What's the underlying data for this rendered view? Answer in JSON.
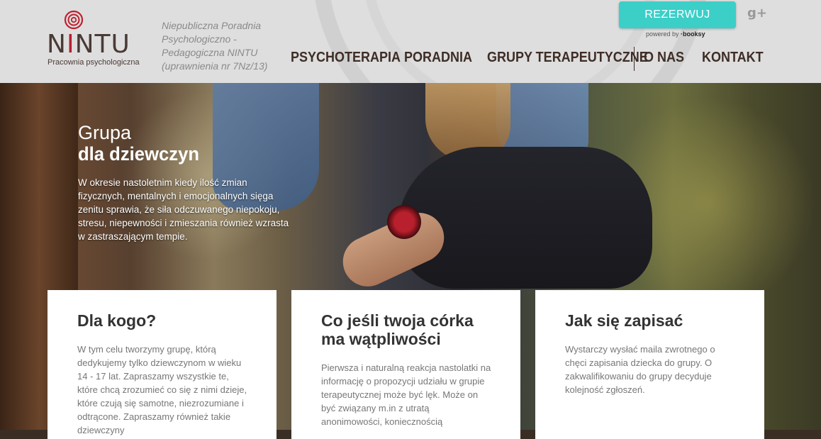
{
  "brand": {
    "name_before": "N",
    "name_i": "I",
    "name_after": "NTU",
    "subtitle": "Pracownia psychologiczna"
  },
  "tagline": [
    "Niepubliczna Poradnia",
    "Psychologiczno -",
    "Pedagogiczna NINTU",
    "(uprawnienia nr 7Nz/13)"
  ],
  "reserve": {
    "label": "REZERWUJ",
    "powered_prefix": "powered by",
    "powered_brand": "booksy",
    "color": "#3bcfc8"
  },
  "social": {
    "icon": "google-plus-icon",
    "glyph": "g+"
  },
  "nav": {
    "items": [
      {
        "label": "PSYCHOTERAPIA"
      },
      {
        "label": "PORADNIA"
      },
      {
        "label": "GRUPY TERAPEUTYCZNE"
      },
      {
        "label": "O NAS"
      },
      {
        "label": "KONTAKT"
      }
    ]
  },
  "hero": {
    "title_line1": "Grupa",
    "title_line2": "dla dziewczyn",
    "text": "W okresie nastoletnim kiedy ilość zmian fizycznych, mentalnych i emocjonalnych sięga zenitu sprawia, że siła odczuwanego niepokoju, stresu, niepewności i zmieszania również wzrasta w zastraszającym tempie."
  },
  "cards": [
    {
      "title": "Dla kogo?",
      "text": "W tym celu tworzymy grupę, którą dedykujemy tylko dziewczynom w wieku 14 - 17 lat. Zapraszamy wszystkie te, które chcą zrozumieć co się z nimi dzieje, które czują się samotne, niezrozumiane i odtrącone. Zapraszamy również takie dziewczyny"
    },
    {
      "title": "Co jeśli twoja córka ma wątpliwości",
      "text": "Pierwsza i naturalną reakcja nastolatki na informację o propozycji udziału w grupie terapeutycznej może być lęk. Może on być związany m.in z utratą anonimowości, koniecznością"
    },
    {
      "title": "Jak się zapisać",
      "text": "Wystarczy wysłać maila zwrotnego o chęci zapisania dziecka do grupy. O zakwalifikowaniu do grupy decyduje kolejność zgłoszeń."
    }
  ]
}
